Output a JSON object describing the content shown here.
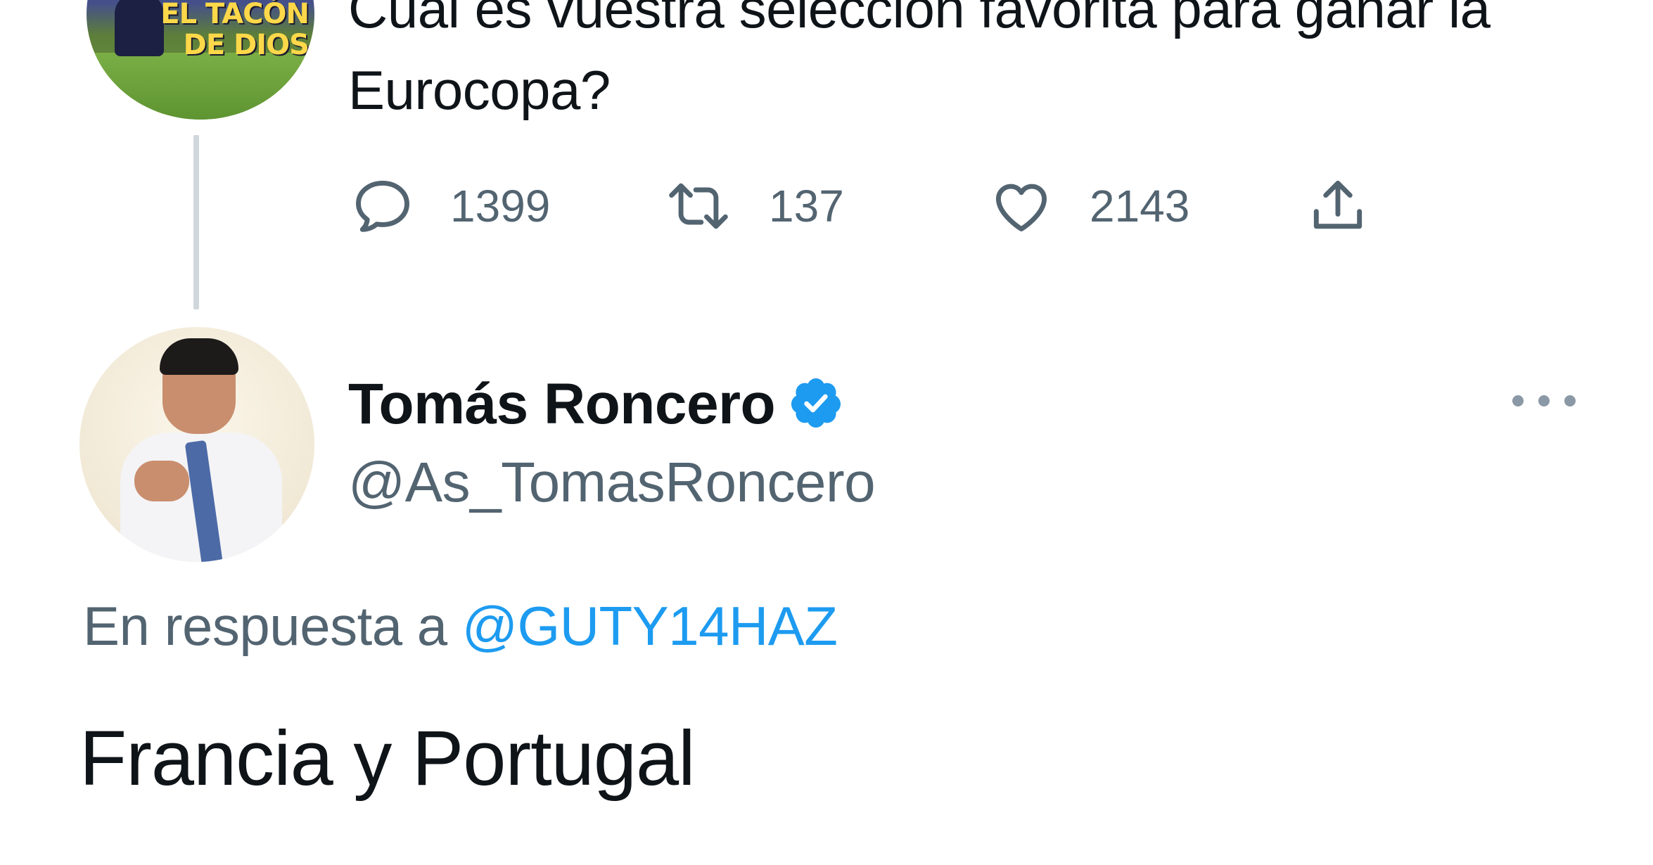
{
  "parent_tweet": {
    "avatar_text_line1": "EL TACÓN",
    "avatar_text_line2": "DE DIOS",
    "text": "Cuál es vuestra selección favorita para ganar la Eurocopa?",
    "actions": {
      "replies": "1399",
      "retweets": "137",
      "likes": "2143"
    }
  },
  "reply_tweet": {
    "display_name": "Tomás Roncero",
    "handle": "@As_TomasRoncero",
    "verified": true,
    "replying_to_prefix": "En respuesta a",
    "replying_to_handle": "@GUTY14HAZ",
    "text": "Francia y Portugal"
  },
  "icons": {
    "reply": "speech-bubble-icon",
    "retweet": "retweet-icon",
    "like": "heart-icon",
    "share": "share-upload-icon",
    "verified": "verified-badge-icon",
    "more": "more-dots-icon"
  },
  "colors": {
    "text_primary": "#0f1419",
    "text_secondary": "#536471",
    "link_blue": "#1d9bf0",
    "verified_blue": "#1d9bf0",
    "thread_line": "#d0d7dc"
  }
}
